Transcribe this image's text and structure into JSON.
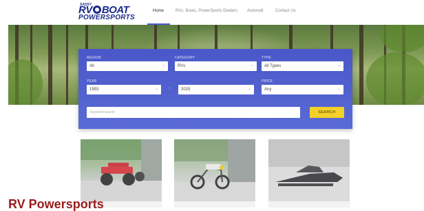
{
  "header": {
    "logo": {
      "superscript": "SASSY",
      "line1": "RV BOAT",
      "line1_left": "RV",
      "line1_right": "BOAT",
      "line2": "POWERSPORTS"
    },
    "nav": [
      {
        "label": "Home",
        "active": true
      },
      {
        "label": "RVs, Boats, PowerSports Dealers",
        "active": false
      },
      {
        "label": "Automall",
        "active": false
      },
      {
        "label": "Contact Us",
        "active": false
      }
    ]
  },
  "search": {
    "region": {
      "label": "REGION",
      "value": "All"
    },
    "category": {
      "label": "CATEGORY",
      "value": "RVs"
    },
    "type": {
      "label": "TYPE",
      "value": "All Types"
    },
    "year": {
      "label": "YEAR",
      "from": "1993",
      "separator": "-",
      "to": "2025"
    },
    "price": {
      "label": "PRICE",
      "value": "Any"
    },
    "keyword_placeholder": "Keyword search",
    "button_label": "SEARCH"
  },
  "listings": [
    {
      "caption": "",
      "subject": "red ATV"
    },
    {
      "caption": "",
      "subject": "dirt bike"
    },
    {
      "caption": "",
      "subject": "snowmobile"
    }
  ],
  "section_title": "RV Powersports",
  "colors": {
    "brand_blue": "#1b2a8a",
    "panel_blue": "#4f5fcc",
    "search_button": "#f3d02a",
    "section_title": "#9b1c1c"
  }
}
